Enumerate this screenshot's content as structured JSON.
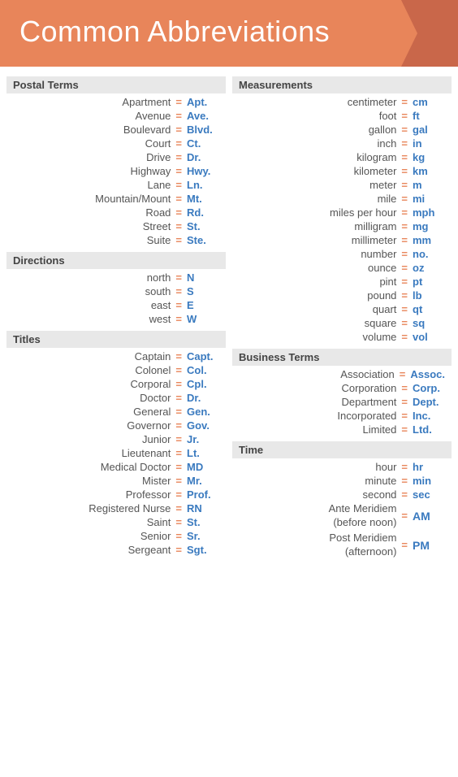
{
  "header": {
    "title": "Common Abbreviations"
  },
  "left": {
    "postal": {
      "header": "Postal Terms",
      "items": [
        {
          "term": "Apartment",
          "abbr": "Apt."
        },
        {
          "term": "Avenue",
          "abbr": "Ave."
        },
        {
          "term": "Boulevard",
          "abbr": "Blvd."
        },
        {
          "term": "Court",
          "abbr": "Ct."
        },
        {
          "term": "Drive",
          "abbr": "Dr."
        },
        {
          "term": "Highway",
          "abbr": "Hwy."
        },
        {
          "term": "Lane",
          "abbr": "Ln."
        },
        {
          "term": "Mountain/Mount",
          "abbr": "Mt."
        },
        {
          "term": "Road",
          "abbr": "Rd."
        },
        {
          "term": "Street",
          "abbr": "St."
        },
        {
          "term": "Suite",
          "abbr": "Ste."
        }
      ]
    },
    "directions": {
      "header": "Directions",
      "items": [
        {
          "term": "north",
          "abbr": "N"
        },
        {
          "term": "south",
          "abbr": "S"
        },
        {
          "term": "east",
          "abbr": "E"
        },
        {
          "term": "west",
          "abbr": "W"
        }
      ]
    },
    "titles": {
      "header": "Titles",
      "items": [
        {
          "term": "Captain",
          "abbr": "Capt."
        },
        {
          "term": "Colonel",
          "abbr": "Col."
        },
        {
          "term": "Corporal",
          "abbr": "Cpl."
        },
        {
          "term": "Doctor",
          "abbr": "Dr."
        },
        {
          "term": "General",
          "abbr": "Gen."
        },
        {
          "term": "Governor",
          "abbr": "Gov."
        },
        {
          "term": "Junior",
          "abbr": "Jr."
        },
        {
          "term": "Lieutenant",
          "abbr": "Lt."
        },
        {
          "term": "Medical Doctor",
          "abbr": "MD"
        },
        {
          "term": "Mister",
          "abbr": "Mr."
        },
        {
          "term": "Professor",
          "abbr": "Prof."
        },
        {
          "term": "Registered Nurse",
          "abbr": "RN"
        },
        {
          "term": "Saint",
          "abbr": "St."
        },
        {
          "term": "Senior",
          "abbr": "Sr."
        },
        {
          "term": "Sergeant",
          "abbr": "Sgt."
        }
      ]
    }
  },
  "right": {
    "measurements": {
      "header": "Measurements",
      "items": [
        {
          "term": "centimeter",
          "abbr": "cm"
        },
        {
          "term": "foot",
          "abbr": "ft"
        },
        {
          "term": "gallon",
          "abbr": "gal"
        },
        {
          "term": "inch",
          "abbr": "in"
        },
        {
          "term": "kilogram",
          "abbr": "kg"
        },
        {
          "term": "kilometer",
          "abbr": "km"
        },
        {
          "term": "meter",
          "abbr": "m"
        },
        {
          "term": "mile",
          "abbr": "mi"
        },
        {
          "term": "miles per hour",
          "abbr": "mph"
        },
        {
          "term": "milligram",
          "abbr": "mg"
        },
        {
          "term": "millimeter",
          "abbr": "mm"
        },
        {
          "term": "number",
          "abbr": "no."
        },
        {
          "term": "ounce",
          "abbr": "oz"
        },
        {
          "term": "pint",
          "abbr": "pt"
        },
        {
          "term": "pound",
          "abbr": "lb"
        },
        {
          "term": "quart",
          "abbr": "qt"
        },
        {
          "term": "square",
          "abbr": "sq"
        },
        {
          "term": "volume",
          "abbr": "vol"
        }
      ]
    },
    "business": {
      "header": "Business Terms",
      "items": [
        {
          "term": "Association",
          "abbr": "Assoc."
        },
        {
          "term": "Corporation",
          "abbr": "Corp."
        },
        {
          "term": "Department",
          "abbr": "Dept."
        },
        {
          "term": "Incorporated",
          "abbr": "Inc."
        },
        {
          "term": "Limited",
          "abbr": "Ltd."
        }
      ]
    },
    "time": {
      "header": "Time",
      "simple": [
        {
          "term": "hour",
          "abbr": "hr"
        },
        {
          "term": "minute",
          "abbr": "min"
        },
        {
          "term": "second",
          "abbr": "sec"
        }
      ],
      "multi": [
        {
          "term_line1": "Ante Meridiem",
          "term_line2": "(before noon)",
          "abbr": "AM"
        },
        {
          "term_line1": "Post Meridiem",
          "term_line2": "(afternoon)",
          "abbr": "PM"
        }
      ]
    }
  },
  "equals_label": "="
}
